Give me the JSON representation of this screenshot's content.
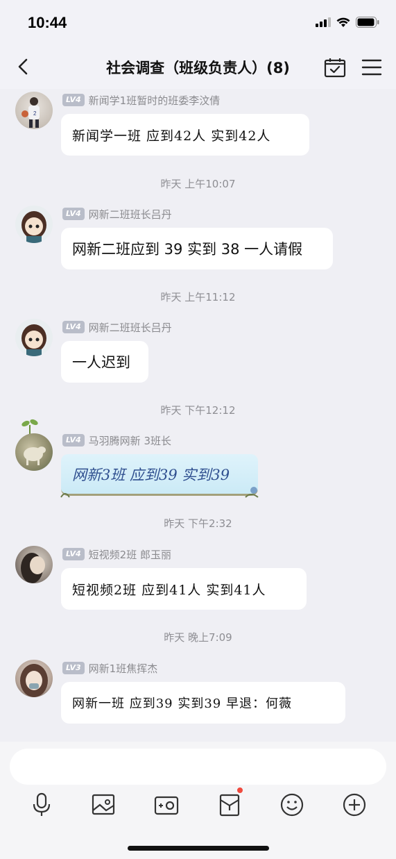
{
  "status": {
    "time": "10:44"
  },
  "header": {
    "title": "社会调查（班级负责人）(8)"
  },
  "messages": [
    {
      "level": "LV4",
      "sender": "新闻学1班暂时的班委李汶倩",
      "text": "新闻学一班 应到42人 实到42人"
    },
    {
      "level": "LV4",
      "sender": "网新二班班长吕丹",
      "text": "网新二班应到 39 实到 38 一人请假"
    },
    {
      "level": "LV4",
      "sender": "网新二班班长吕丹",
      "text": "一人迟到"
    },
    {
      "level": "LV4",
      "sender": "马羽腾网新 3班长",
      "text": "网新3班 应到39 实到39"
    },
    {
      "level": "LV4",
      "sender": "短视频2班 郎玉丽",
      "text": "短视频2班 应到41人 实到41人"
    },
    {
      "level": "LV3",
      "sender": "网新1班焦挥杰",
      "text": "网新一班 应到39 实到39 早退：何薇"
    }
  ],
  "timestamps": [
    "昨天 上午10:07",
    "昨天 上午11:12",
    "昨天 下午12:12",
    "昨天 下午2:32",
    "昨天 晚上7:09"
  ],
  "input": {
    "placeholder": ""
  },
  "colors": {
    "background": "#efeff4",
    "bubble": "#ffffff",
    "level_badge": "#b9bdc9",
    "notify_dot": "#f04a3e"
  },
  "icons": [
    "back-icon",
    "calendar-check-icon",
    "menu-icon",
    "microphone-icon",
    "image-icon",
    "camera-icon",
    "red-packet-icon",
    "emoji-icon",
    "plus-icon"
  ]
}
